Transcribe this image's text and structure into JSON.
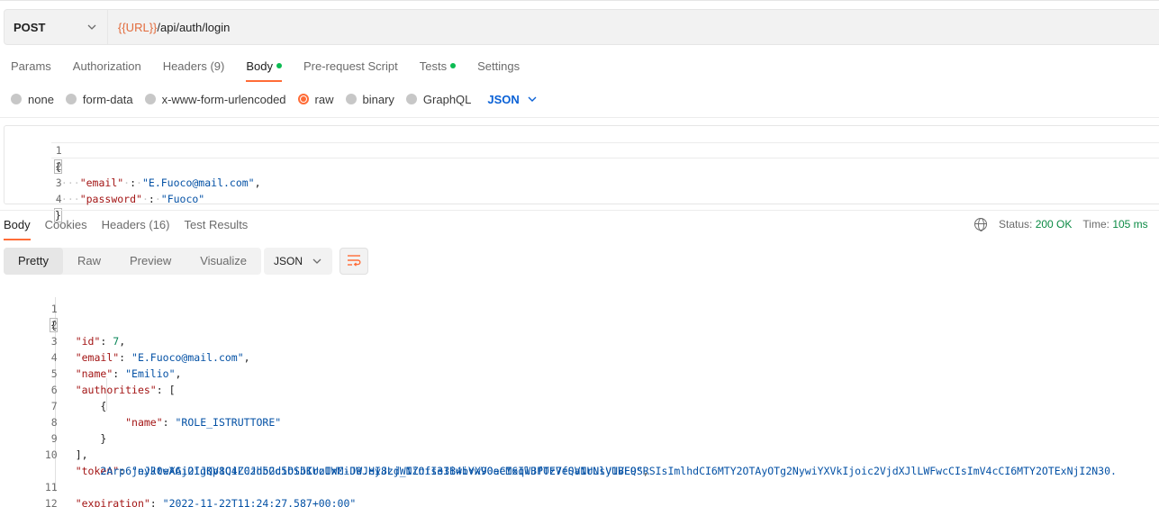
{
  "request": {
    "method": "POST",
    "url_var": "{{URL}}",
    "url_path": "/api/auth/login"
  },
  "request_tabs": [
    {
      "label": "Params"
    },
    {
      "label": "Authorization"
    },
    {
      "label": "Headers",
      "count": "(9)"
    },
    {
      "label": "Body",
      "active": true,
      "dot": true
    },
    {
      "label": "Pre-request Script"
    },
    {
      "label": "Tests",
      "dot": true
    },
    {
      "label": "Settings"
    }
  ],
  "body_types": [
    "none",
    "form-data",
    "x-www-form-urlencoded",
    "raw",
    "binary",
    "GraphQL"
  ],
  "body_type_selected": "raw",
  "body_language": "JSON",
  "request_body": {
    "line_numbers": [
      "1",
      "2",
      "3",
      "4"
    ],
    "open_brace": "{",
    "key1": "\"email\"",
    "value1": "\"E.Fuoco@mail.com\"",
    "key2": "\"password\"",
    "value2": "\"Fuoco\"",
    "close_brace": "}"
  },
  "response_tabs": [
    {
      "label": "Body",
      "active": true
    },
    {
      "label": "Cookies"
    },
    {
      "label": "Headers",
      "count": "(16)"
    },
    {
      "label": "Test Results"
    }
  ],
  "response_meta": {
    "status_label": "Status:",
    "status_value": "200 OK",
    "time_label": "Time:",
    "time_value": "105 ms",
    "size_label_truncated": "S"
  },
  "view_modes": [
    "Pretty",
    "Raw",
    "Preview",
    "Visualize"
  ],
  "view_mode_active": "Pretty",
  "response_format": "JSON",
  "response_body": {
    "line_numbers": [
      "1",
      "2",
      "3",
      "4",
      "5",
      "6",
      "7",
      "8",
      "9",
      "10",
      "",
      "11",
      "12"
    ],
    "id_key": "\"id\"",
    "id_value": "7",
    "email_key": "\"email\"",
    "email_value": "\"E.Fuoco@mail.com\"",
    "name_key": "\"name\"",
    "name_value": "\"Emilio\"",
    "authorities_key": "\"authorities\"",
    "role_key": "\"name\"",
    "role_value": "\"ROLE_ISTRUTTORE\"",
    "token_key": "\"token\"",
    "token_value_part1": "\"eyJ0eXAiOiJKV1QiLCJhbGciOiJIUzUxMiJ9.eyJzdWIiOiI3IiwiYXV0aCI6IlJPTEVfSVNUUlVUVE9SRSIsImlhdCI6MTY2OTAyOTg2NywiYXVkIjoic2VjdXJlLWFwcCIsImV4cCI6MTY2OTExNjI2N30.",
    "token_value_part2": "2Arp6jnJktwAGj2IgQp8C4Z0zd52d5bSbKroIWC-DWJHI8Lj_NZnfse3B4bvw9OeeMxqWBf0z7eQaIrNsy1BLQ\"",
    "expiration_key": "\"expiration\"",
    "expiration_value": "\"2022-11-22T11:24:27.587+00:00\""
  }
}
